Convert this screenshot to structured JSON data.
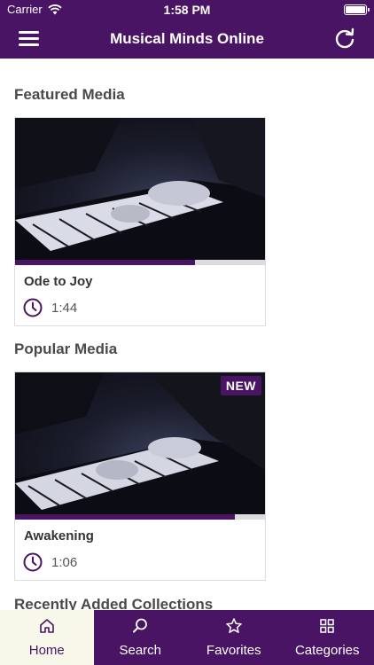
{
  "status": {
    "carrier": "Carrier",
    "time": "1:58 PM"
  },
  "nav": {
    "title": "Musical Minds Online"
  },
  "sections": {
    "featured": "Featured Media",
    "popular": "Popular Media",
    "recent": "Recently Added Collections"
  },
  "featured_item": {
    "title": "Ode to Joy",
    "duration": "1:44",
    "progress": 0.72
  },
  "popular_item": {
    "title": "Awakening",
    "duration": "1:06",
    "progress": 0.88,
    "badge": "NEW"
  },
  "tabs": [
    {
      "label": "Home",
      "icon": "home-icon",
      "active": true
    },
    {
      "label": "Search",
      "icon": "search-icon",
      "active": false
    },
    {
      "label": "Favorites",
      "icon": "star-icon",
      "active": false
    },
    {
      "label": "Categories",
      "icon": "grid-icon",
      "active": false
    }
  ],
  "colors": {
    "brand": "#4a1464",
    "active_tab_bg": "#f7f7ea"
  }
}
